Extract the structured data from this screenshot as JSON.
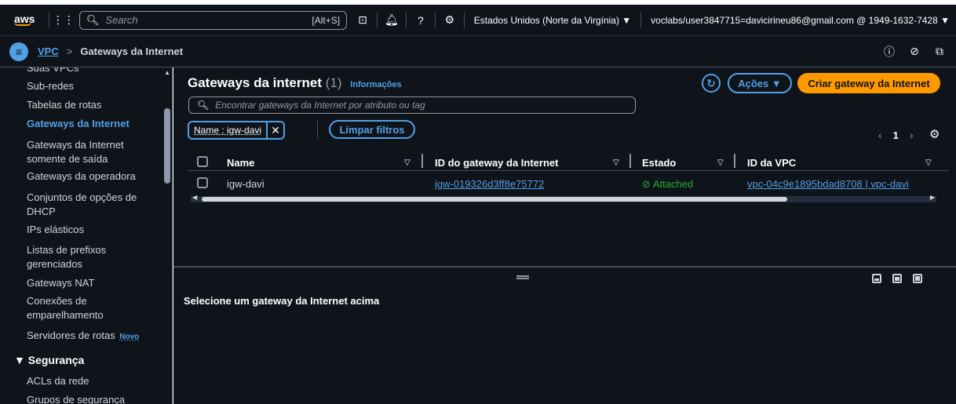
{
  "topnav": {
    "logo": "aws",
    "search_placeholder": "Search",
    "search_shortcut": "[Alt+S]",
    "region": "Estados Unidos (Norte da Virgínia) ▼",
    "account": "voclabs/user3847715=davicirineu86@gmail.com @ 1949-1632-7428 ▼"
  },
  "breadcrumb": {
    "service": "VPC",
    "current": "Gateways da Internet"
  },
  "sidebar": {
    "cut_item": "Suas VPCs",
    "items": [
      "Sub-redes",
      "Tabelas de rotas",
      "Gateways da Internet",
      "Gateways da Internet somente de saída",
      "Gateways da operadora",
      "Conjuntos de opções de DHCP",
      "IPs elásticos",
      "Listas de prefixos gerenciados",
      "Gateways NAT",
      "Conexões de emparelhamento",
      "Servidores de rotas"
    ],
    "new_badge": "Novo",
    "section": "Segurança",
    "section_items": [
      "ACLs da rede",
      "Grupos de segurança"
    ]
  },
  "main": {
    "title": "Gateways da internet",
    "count": "(1)",
    "info_link": "Informações",
    "actions_label": "Ações ▼",
    "create_label": "Criar gateway da Internet",
    "filter_placeholder": "Encontrar gateways da Internet por atributo ou tag",
    "token_label": "Name : igw-davi",
    "clear_filters": "Limpar filtros",
    "page": "1"
  },
  "table": {
    "columns": [
      "Name",
      "ID do gateway da Internet",
      "Estado",
      "ID da VPC"
    ],
    "rows": [
      {
        "name": "igw-davi",
        "id": "igw-019326d3ff8e75772",
        "state": "Attached",
        "vpc": "vpc-04c9e1895bdad8708 | vpc-davi"
      }
    ]
  },
  "detail": {
    "message": "Selecione um gateway da Internet acima"
  }
}
